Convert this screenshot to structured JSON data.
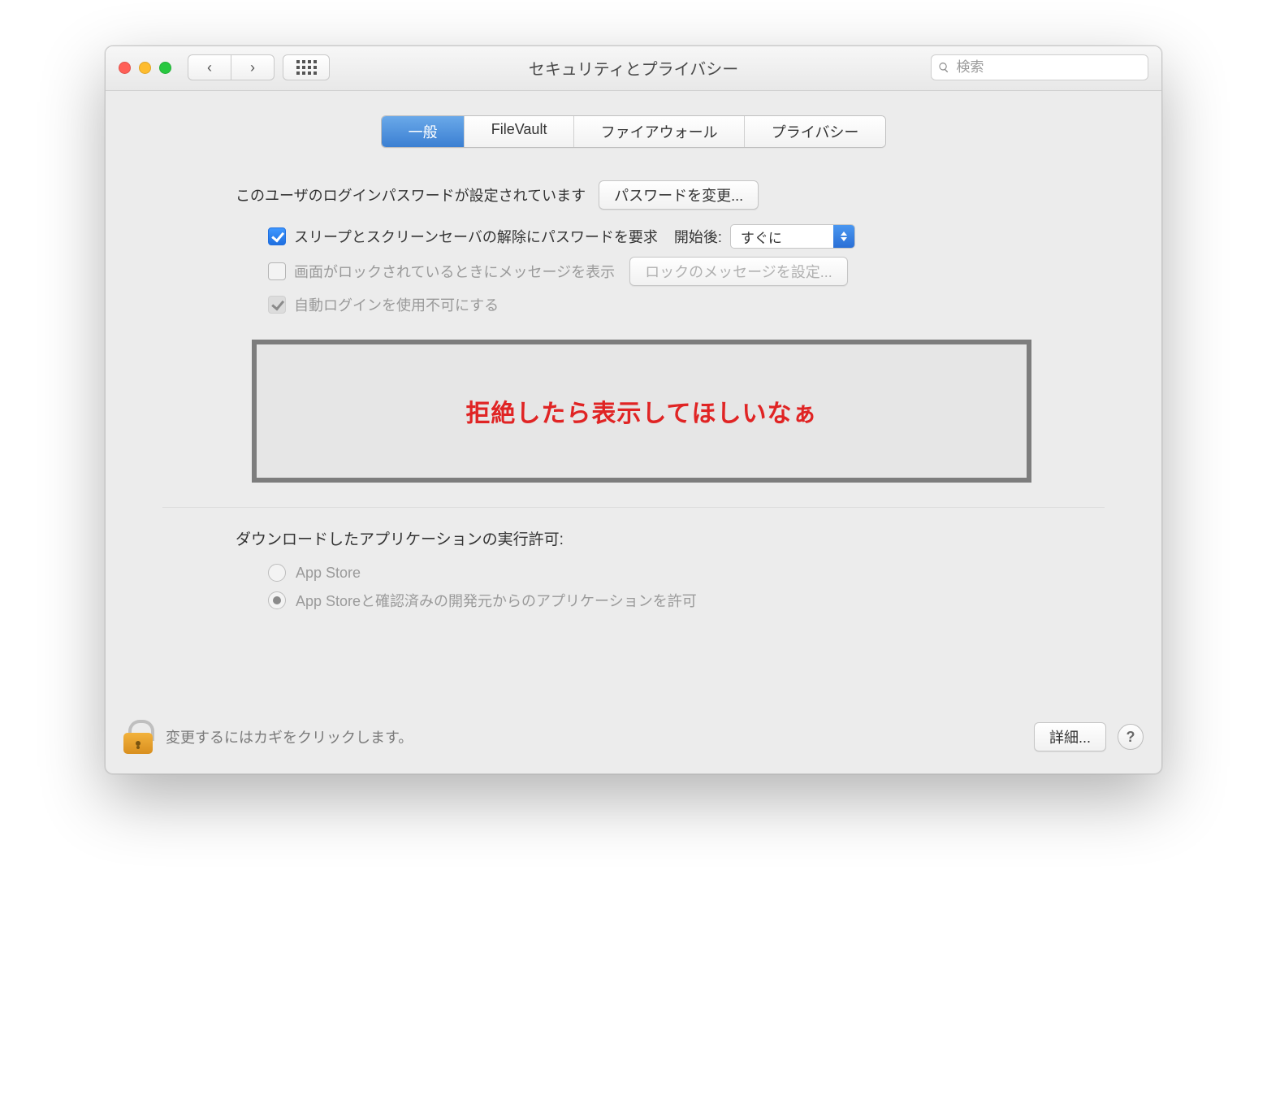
{
  "window": {
    "title": "セキュリティとプライバシー"
  },
  "toolbar": {
    "search_placeholder": "検索"
  },
  "tabs": {
    "general": "一般",
    "filevault": "FileVault",
    "firewall": "ファイアウォール",
    "privacy": "プライバシー",
    "active": "general"
  },
  "login": {
    "password_set_text": "このユーザのログインパスワードが設定されています",
    "change_password_button": "パスワードを変更...",
    "require_password_label": "スリープとスクリーンセーバの解除にパスワードを要求",
    "after_label": "開始後:",
    "after_value": "すぐに",
    "lock_message_label": "画面がロックされているときにメッセージを表示",
    "set_lock_message_button": "ロックのメッセージを設定...",
    "disable_autologin_label": "自動ログインを使用不可にする",
    "require_password_checked": true,
    "lock_message_checked": false,
    "disable_autologin_checked": true
  },
  "annotation": {
    "text": "拒絶したら表示してほしいなぁ"
  },
  "downloads": {
    "title": "ダウンロードしたアプリケーションの実行許可:",
    "opt_appstore": "App Store",
    "opt_identified": "App Storeと確認済みの開発元からのアプリケーションを許可",
    "selected": "identified"
  },
  "footer": {
    "lock_text": "変更するにはカギをクリックします。",
    "advanced_button": "詳細...",
    "help": "?"
  }
}
